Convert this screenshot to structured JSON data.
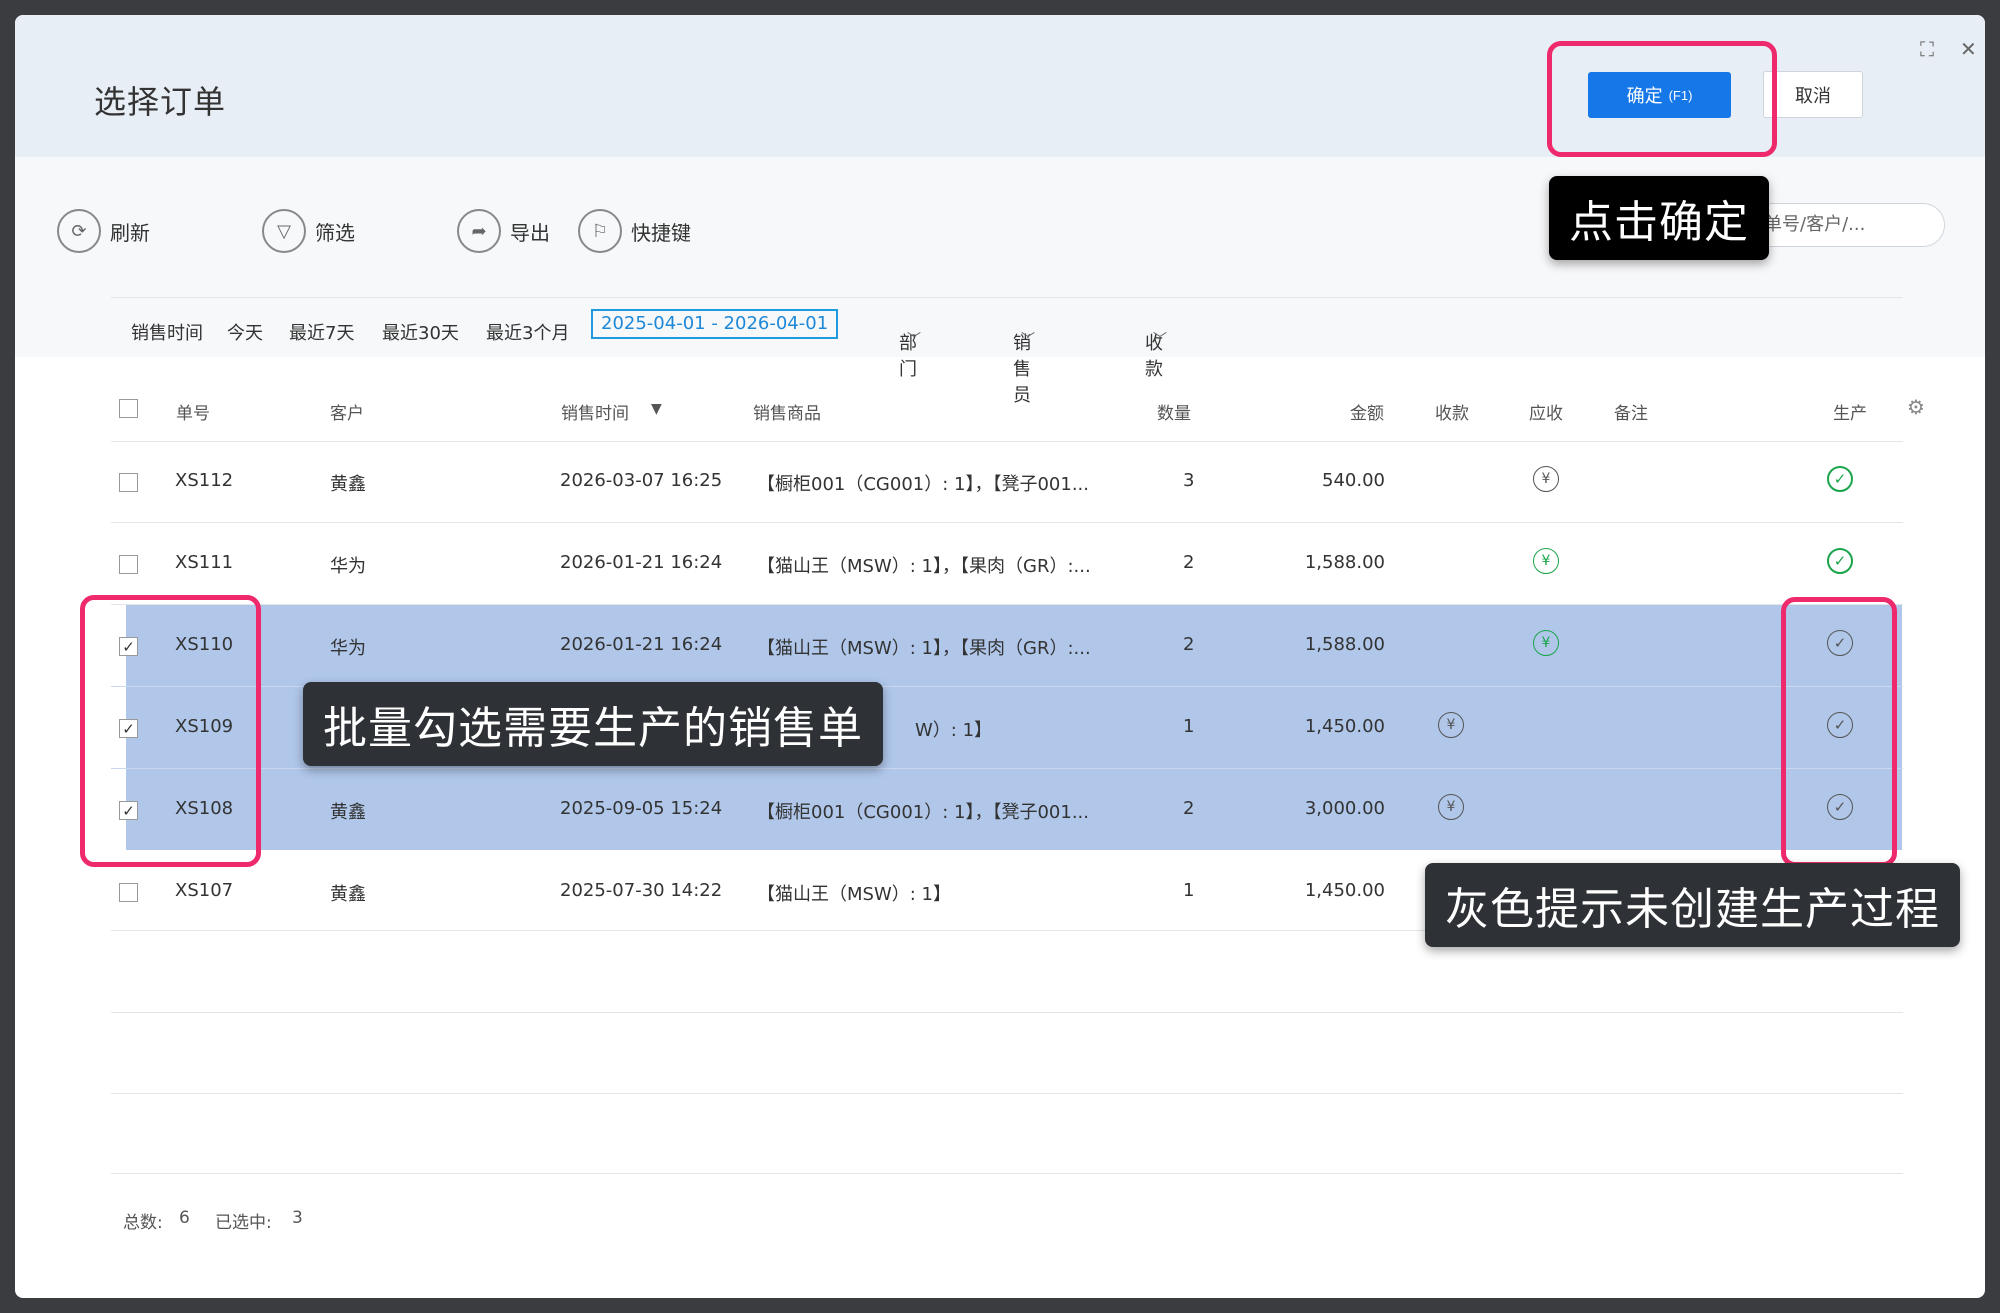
{
  "dialog": {
    "title": "选择订单",
    "ok_label": "确定",
    "ok_key": "(F1)",
    "cancel_label": "取消"
  },
  "toolbar": {
    "refresh": "刷新",
    "filter": "筛选",
    "export": "导出",
    "shortcuts": "快捷键",
    "search_placeholder": "单号/客户/..."
  },
  "datebar": {
    "label": "销售时间",
    "today": "今天",
    "last7": "最近7天",
    "last30": "最近30天",
    "last3m": "最近3个月",
    "range": "2025-04-01 - 2026-04-01",
    "dept": "部门",
    "salesman": "销售员",
    "payment": "收款"
  },
  "table": {
    "headers": {
      "no": "单号",
      "customer": "客户",
      "time": "销售时间",
      "sort": "▼",
      "goods": "销售商品",
      "qty": "数量",
      "amount": "金额",
      "received": "收款",
      "receivable": "应收",
      "remark": "备注",
      "production": "生产"
    },
    "rows": [
      {
        "no": "XS112",
        "customer": "黄鑫",
        "time": "2026-03-07 16:25",
        "goods": "【橱柜001（CG001）: 1】，【凳子001...",
        "qty": "3",
        "amount": "540.00"
      },
      {
        "no": "XS111",
        "customer": "华为",
        "time": "2026-01-21 16:24",
        "goods": "【猫山王（MSW）: 1】，【果肉（GR）:...",
        "qty": "2",
        "amount": "1,588.00"
      },
      {
        "no": "XS110",
        "customer": "华为",
        "time": "2026-01-21 16:24",
        "goods": "【猫山王（MSW）: 1】，【果肉（GR）:...",
        "qty": "2",
        "amount": "1,588.00"
      },
      {
        "no": "XS109",
        "customer": "",
        "time": "",
        "goods": "W）: 1】",
        "qty": "1",
        "amount": "1,450.00"
      },
      {
        "no": "XS108",
        "customer": "黄鑫",
        "time": "2025-09-05 15:24",
        "goods": "【橱柜001（CG001）: 1】，【凳子001...",
        "qty": "2",
        "amount": "3,000.00"
      },
      {
        "no": "XS107",
        "customer": "黄鑫",
        "time": "2025-07-30 14:22",
        "goods": "【猫山王（MSW）: 1】",
        "qty": "1",
        "amount": "1,450.00"
      }
    ]
  },
  "footer": {
    "total_label": "总数:",
    "total": "6",
    "selected_label": "已选中:",
    "selected": "3"
  },
  "annotations": {
    "tip_ok": "点击确定",
    "tip_select": "批量勾选需要生产的销售单",
    "tip_gray": "灰色提示未创建生产过程"
  },
  "icons": {
    "yen": "¥",
    "check": "✓",
    "checkbox_checked": "✓"
  }
}
